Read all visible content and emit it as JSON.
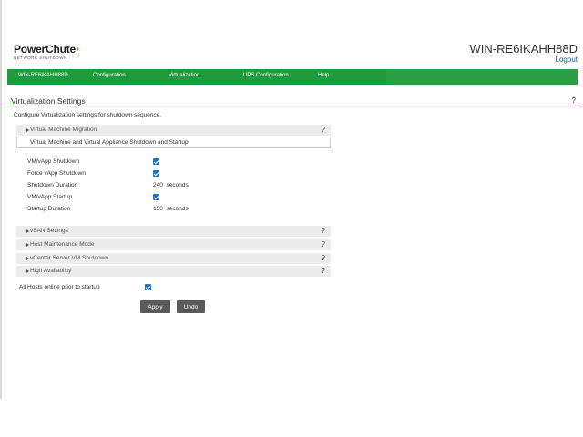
{
  "header": {
    "logo_name": "PowerChute",
    "logo_sub": "NETWORK SHUTDOWN",
    "hostname": "WIN-RE6IKAHH88D",
    "logout": "Logout"
  },
  "nav": {
    "items": [
      "WIN-RE6IKAHH88D",
      "Configuration",
      "Virtualization",
      "UPS Configuration",
      "Help"
    ]
  },
  "section": {
    "title": "Virtualization Settings",
    "help": "?",
    "description": "Configure Virtualization settings for shutdown sequence."
  },
  "panels": {
    "migration": {
      "label": "Virtual Machine Migration",
      "help": "?"
    },
    "vsan": {
      "label": "vSAN Settings",
      "help": "?"
    },
    "maintenance": {
      "label": "Host Maintenance Mode",
      "help": "?"
    },
    "vcenter": {
      "label": "vCenter Server VM Shutdown",
      "help": "?"
    },
    "ha": {
      "label": "High Availability",
      "help": "?"
    }
  },
  "subpanel": {
    "label": "Virtual Machine and Virtual Appliance Shutdown and Startup"
  },
  "fields": {
    "vm_shutdown": {
      "label": "VM/vApp Shutdown",
      "checked": true
    },
    "force_shutdown": {
      "label": "Force vApp Shutdown",
      "checked": true
    },
    "shutdown_duration": {
      "label": "Shutdown Duration",
      "value": "240",
      "unit": "seconds"
    },
    "vm_startup": {
      "label": "VM/vApp Startup",
      "checked": true
    },
    "startup_duration": {
      "label": "Startup Duration",
      "value": "150",
      "unit": "seconds"
    },
    "all_hosts": {
      "label": "All Hosts online prior to startup",
      "checked": true
    }
  },
  "buttons": {
    "apply": "Apply",
    "undo": "Undo"
  },
  "colors": {
    "nav_green": "#1f9a3c",
    "accent_green": "#3dae2b",
    "checkbox_blue": "#1a73c9",
    "button_gray": "#5a5a5a"
  }
}
